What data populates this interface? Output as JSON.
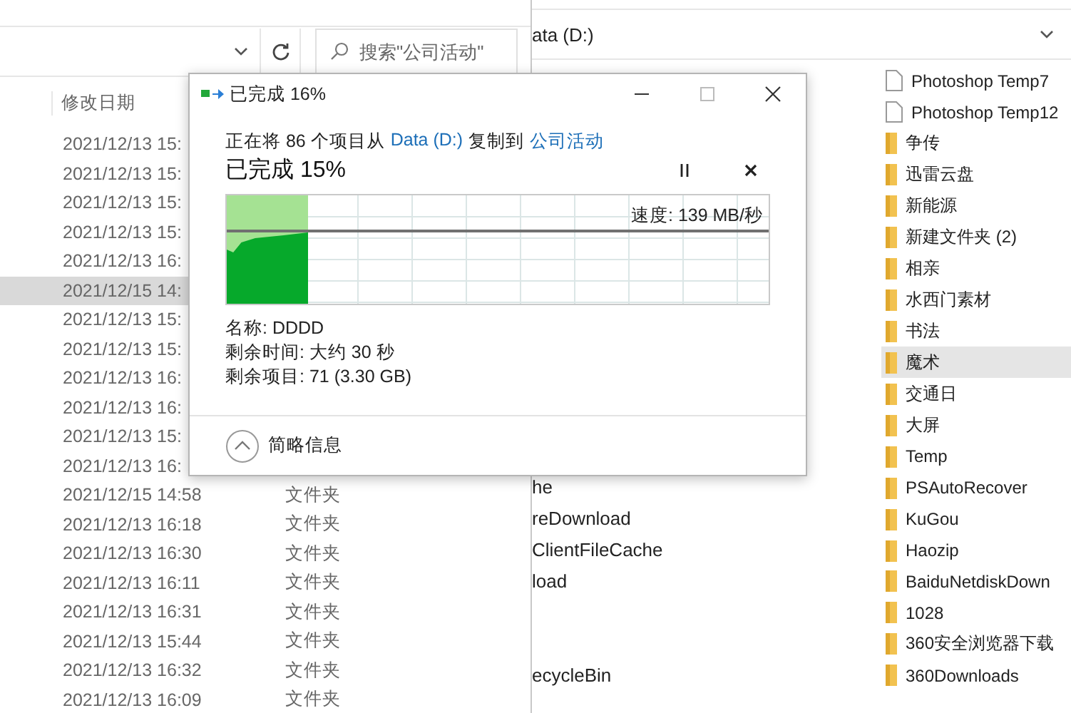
{
  "left_window": {
    "search": {
      "placeholder": "搜索\"公司活动\""
    },
    "column_header": "修改日期",
    "rows": [
      {
        "date": "2021/12/13 15:",
        "selected": false
      },
      {
        "date": "2021/12/13 15:",
        "selected": false
      },
      {
        "date": "2021/12/13 15:",
        "selected": false
      },
      {
        "date": "2021/12/13 15:",
        "selected": false
      },
      {
        "date": "2021/12/13 16:",
        "selected": false
      },
      {
        "date": "2021/12/15 14:",
        "selected": true
      },
      {
        "date": "2021/12/13 15:",
        "selected": false
      },
      {
        "date": "2021/12/13 15:",
        "selected": false
      },
      {
        "date": "2021/12/13 16:",
        "selected": false
      },
      {
        "date": "2021/12/13 16:",
        "selected": false
      },
      {
        "date": "2021/12/13 15:",
        "selected": false
      },
      {
        "date": "2021/12/13 16:",
        "selected": false
      },
      {
        "date": "2021/12/15 14:58",
        "type": "文件夹",
        "selected": false
      },
      {
        "date": "2021/12/13 16:18",
        "type": "文件夹",
        "selected": false
      },
      {
        "date": "2021/12/13 16:30",
        "type": "文件夹",
        "selected": false
      },
      {
        "date": "2021/12/13 16:11",
        "type": "文件夹",
        "selected": false
      },
      {
        "date": "2021/12/13 16:31",
        "type": "文件夹",
        "selected": false
      },
      {
        "date": "2021/12/13 15:44",
        "type": "文件夹",
        "selected": false
      },
      {
        "date": "2021/12/13 16:32",
        "type": "文件夹",
        "selected": false
      },
      {
        "date": "2021/12/13 16:09",
        "type": "文件夹",
        "selected": false
      }
    ]
  },
  "right_window": {
    "address": "ata (D:)",
    "middle_items": [
      "he",
      "reDownload",
      "ClientFileCache",
      "load",
      "ecycleBin"
    ],
    "items": [
      {
        "name": "Photoshop Temp7",
        "kind": "file",
        "selected": false
      },
      {
        "name": "Photoshop Temp12",
        "kind": "file",
        "selected": false
      },
      {
        "name": "争传",
        "kind": "folder",
        "selected": false
      },
      {
        "name": "迅雷云盘",
        "kind": "folder",
        "selected": false
      },
      {
        "name": "新能源",
        "kind": "folder",
        "selected": false
      },
      {
        "name": "新建文件夹 (2)",
        "kind": "folder",
        "selected": false
      },
      {
        "name": "相亲",
        "kind": "folder",
        "selected": false
      },
      {
        "name": "水西门素材",
        "kind": "folder",
        "selected": false
      },
      {
        "name": "书法",
        "kind": "folder",
        "selected": false
      },
      {
        "name": "魔术",
        "kind": "folder",
        "selected": true
      },
      {
        "name": "交通日",
        "kind": "folder",
        "selected": false
      },
      {
        "name": "大屏",
        "kind": "folder",
        "selected": false
      },
      {
        "name": "Temp",
        "kind": "folder",
        "selected": false
      },
      {
        "name": "PSAutoRecover",
        "kind": "folder",
        "selected": false
      },
      {
        "name": "KuGou",
        "kind": "folder",
        "selected": false
      },
      {
        "name": "Haozip",
        "kind": "folder",
        "selected": false
      },
      {
        "name": "BaiduNetdiskDown",
        "kind": "folder",
        "selected": false
      },
      {
        "name": "1028",
        "kind": "folder",
        "selected": false
      },
      {
        "name": "360安全浏览器下载",
        "kind": "folder",
        "selected": false
      },
      {
        "name": "360Downloads",
        "kind": "folder",
        "selected": false
      }
    ]
  },
  "dialog": {
    "title": "已完成 16%",
    "summary": {
      "before": "正在将 86 个项目从",
      "source": "Data (D:)",
      "middle": "复制到",
      "destination": "公司活动"
    },
    "progress_title": "已完成 15%",
    "progress": {
      "level": 0.15
    },
    "speed": "速度: 139 MB/秒",
    "details": [
      "名称: DDDD",
      "剩余时间: 大约 30 秒",
      "剩余项目: 71 (3.30 GB)"
    ],
    "toggle": "简略信息"
  }
}
